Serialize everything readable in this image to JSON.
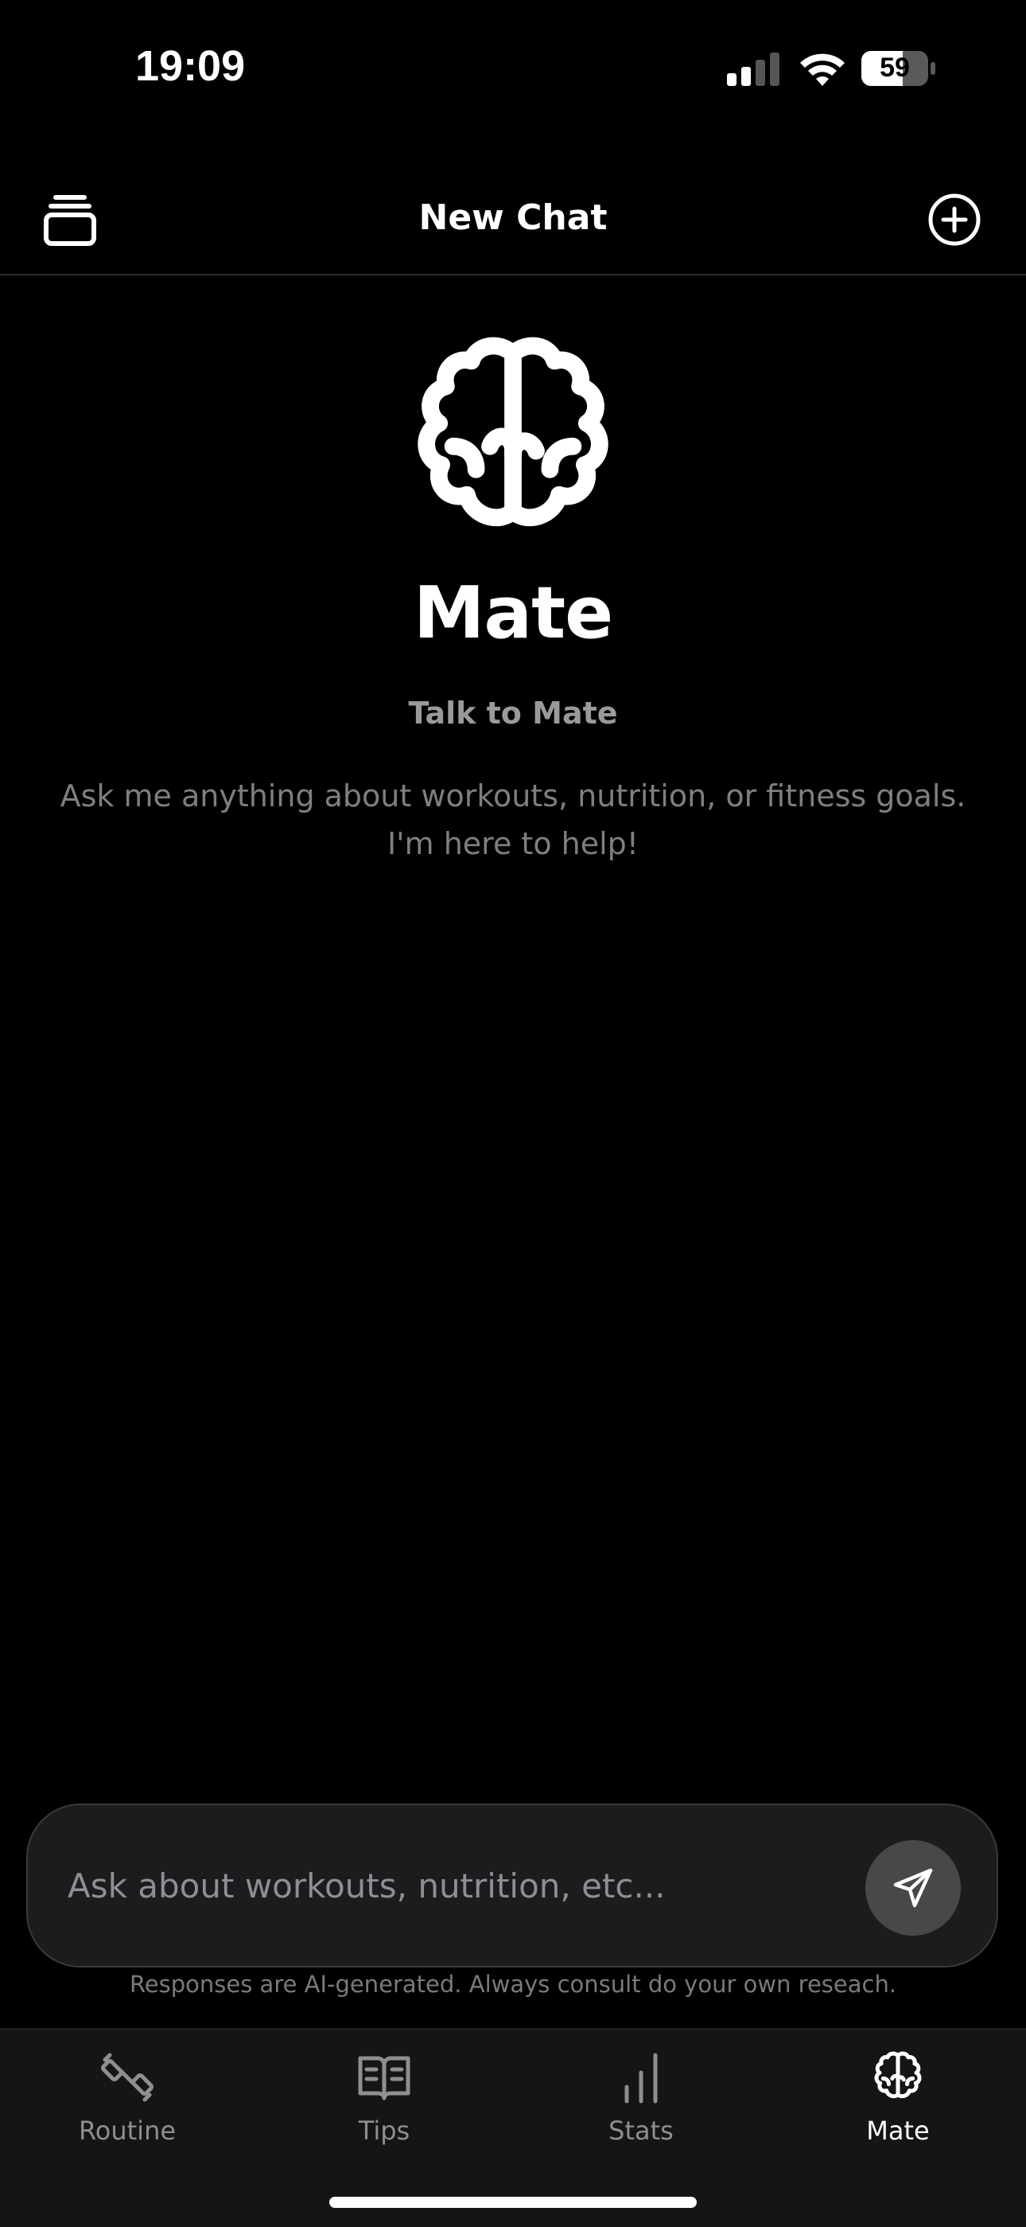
{
  "status_bar": {
    "time": "19:09",
    "battery_level": "59",
    "icons": [
      "signal-icon",
      "wifi-icon",
      "battery-icon"
    ]
  },
  "header": {
    "title": "New Chat",
    "left_icon": "history-stack-icon",
    "right_icon": "plus-circle-icon"
  },
  "hero": {
    "icon": "brain-icon",
    "title": "Mate",
    "subtitle": "Talk to Mate",
    "description": "Ask me anything about workouts, nutrition, or fitness goals. I'm here to help!"
  },
  "chat_input": {
    "placeholder": "Ask about workouts, nutrition, etc...",
    "value": "",
    "send_icon": "send-icon"
  },
  "disclaimer": "Responses are AI-generated. Always consult do your own reseach.",
  "tab_bar": {
    "tabs": [
      {
        "label": "Routine",
        "icon": "dumbbell-icon",
        "active": false
      },
      {
        "label": "Tips",
        "icon": "book-icon",
        "active": false
      },
      {
        "label": "Stats",
        "icon": "bar-chart-icon",
        "active": false
      },
      {
        "label": "Mate",
        "icon": "brain-icon",
        "active": true
      }
    ]
  },
  "colors": {
    "background": "#000000",
    "text_primary": "#ffffff",
    "text_secondary": "#9a9a9a",
    "input_bg": "#1c1c1e",
    "send_button_bg": "#48484a",
    "tab_inactive": "#8e8e93"
  }
}
